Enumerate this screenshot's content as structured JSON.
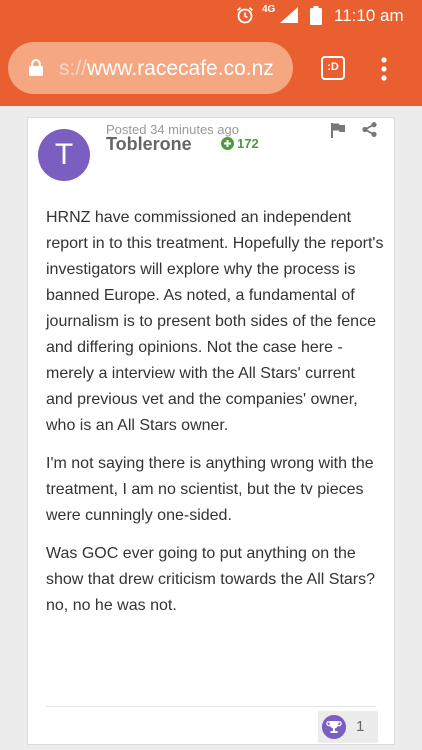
{
  "status_bar": {
    "network": "4G",
    "time": "11:10 am"
  },
  "browser": {
    "url_scheme": "s://",
    "url_host": "www.racecafe.co.nz",
    "tabs_label": ":D"
  },
  "post": {
    "avatar_letter": "T",
    "timestamp": "Posted 34 minutes ago",
    "author": "Toblerone",
    "reputation": "172",
    "paragraphs": [
      "HRNZ have commissioned an independent report in to this treatment. Hopefully the report's investigators will explore why the process is banned Europe. As noted, a fundamental of journalism is to present both sides of the fence and differing opinions. Not the case here - merely a interview with the All Stars' current and previous vet and the companies' owner, who is an All Stars owner.",
      "I'm not saying there is anything wrong with the treatment, I am no scientist, but the tv pieces were cunningly one-sided.",
      "Was GOC ever going to put anything on the show that drew criticism towards the All Stars? no, no he was not."
    ],
    "reaction_count": "1"
  },
  "colors": {
    "brand": "#ea5f2f",
    "avatar": "#7a5fc0",
    "reputation": "#4e9a3f"
  },
  "icons": [
    "alarm-clock-icon",
    "signal-icon",
    "battery-icon",
    "lock-icon",
    "menu-dots-icon",
    "reputation-plus-icon",
    "flag-icon",
    "share-icon",
    "trophy-icon"
  ]
}
